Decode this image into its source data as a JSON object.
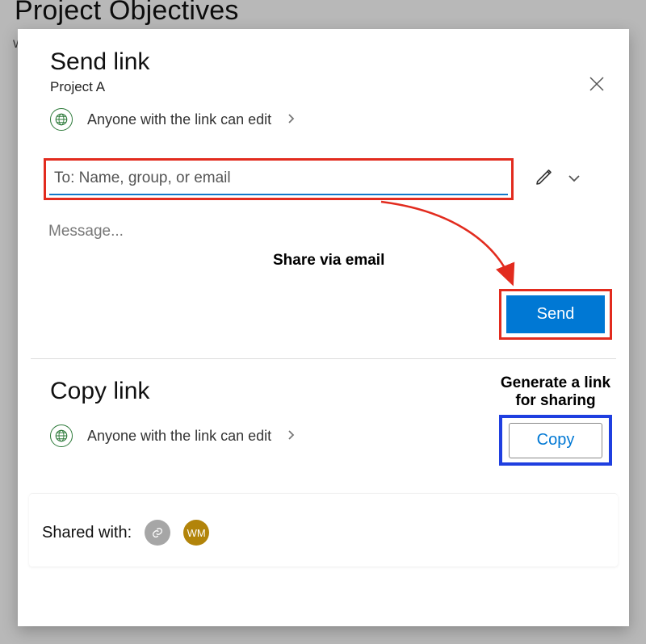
{
  "page_title": "Project Objectives",
  "page_stub": "W",
  "dialog": {
    "title": "Send link",
    "subtitle": "Project A",
    "permission_text": "Anyone with the link can edit",
    "to_placeholder": "To: Name, group, or email",
    "message_placeholder": "Message...",
    "send_label": "Send",
    "copy_section_title": "Copy link",
    "copy_label": "Copy",
    "shared_with_label": "Shared with:",
    "avatars": {
      "initials": "WM"
    }
  },
  "annotations": {
    "share_via_email": "Share via email",
    "generate_link_l1": "Generate a link",
    "generate_link_l2": "for sharing"
  },
  "colors": {
    "primary": "#0078d4",
    "highlight_red": "#e22b1e",
    "highlight_blue": "#1f3fe0",
    "green": "#2d7a3a"
  }
}
